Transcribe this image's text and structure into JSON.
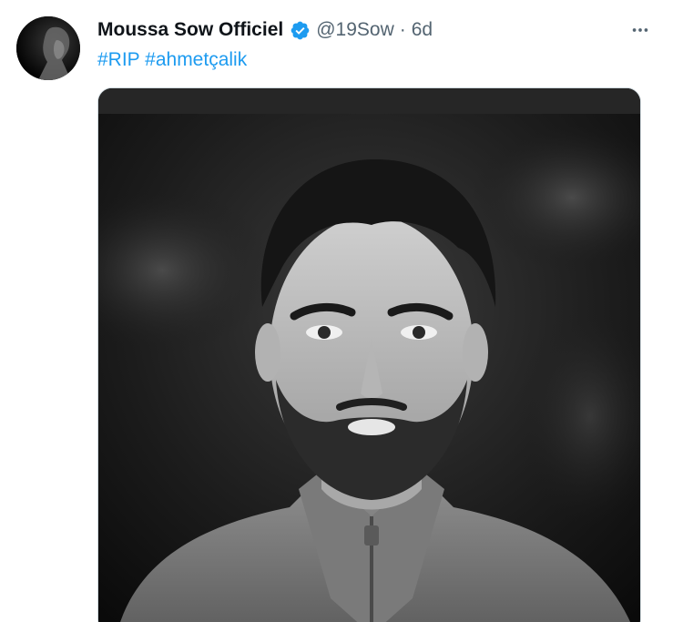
{
  "tweet": {
    "author": {
      "display_name": "Moussa Sow Officiel",
      "handle": "@19Sow",
      "verified": true,
      "avatar": "profile-photo"
    },
    "separator": "·",
    "time": "6d",
    "hashtags": [
      "#RIP",
      "#ahmetçalik"
    ],
    "media": {
      "type": "photo",
      "description_icon": "portrait-photo"
    },
    "more_icon": "more-horizontal-icon"
  },
  "colors": {
    "link": "#1d9bf0",
    "text": "#0f1419",
    "secondary": "#536471",
    "verified": "#1d9bf0"
  }
}
